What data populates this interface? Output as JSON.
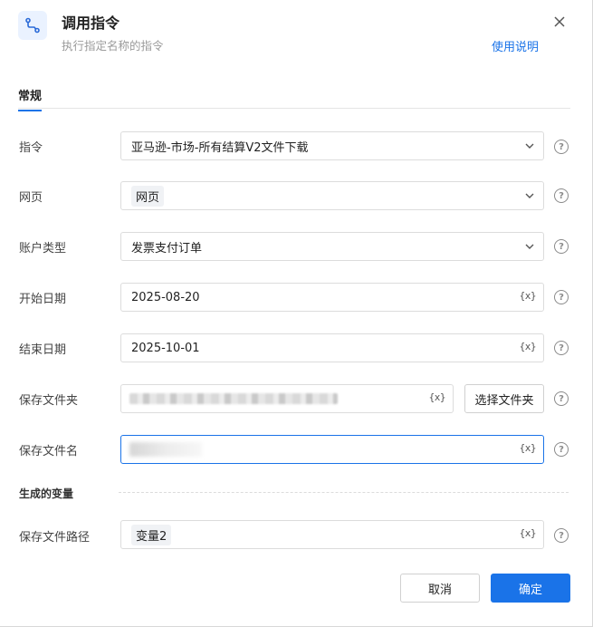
{
  "dialog": {
    "title": "调用指令",
    "subtitle": "执行指定名称的指令",
    "help_link": "使用说明",
    "tab_general": "常规"
  },
  "fields": {
    "command": {
      "label": "指令",
      "value": "亚马逊-市场-所有结算V2文件下载"
    },
    "webpage": {
      "label": "网页",
      "value": "网页"
    },
    "account_type": {
      "label": "账户类型",
      "value": "发票支付订单"
    },
    "start_date": {
      "label": "开始日期",
      "value": "2025-08-20"
    },
    "end_date": {
      "label": "结束日期",
      "value": "2025-10-01"
    },
    "save_folder": {
      "label": "保存文件夹",
      "button": "选择文件夹"
    },
    "save_filename": {
      "label": "保存文件名"
    },
    "save_path": {
      "label": "保存文件路径",
      "value": "变量2"
    }
  },
  "section_generated": "生成的变量",
  "var_icon_text": "{x}",
  "help_mark": "?",
  "buttons": {
    "cancel": "取消",
    "ok": "确定"
  },
  "colors": {
    "accent": "#1a73e8"
  }
}
